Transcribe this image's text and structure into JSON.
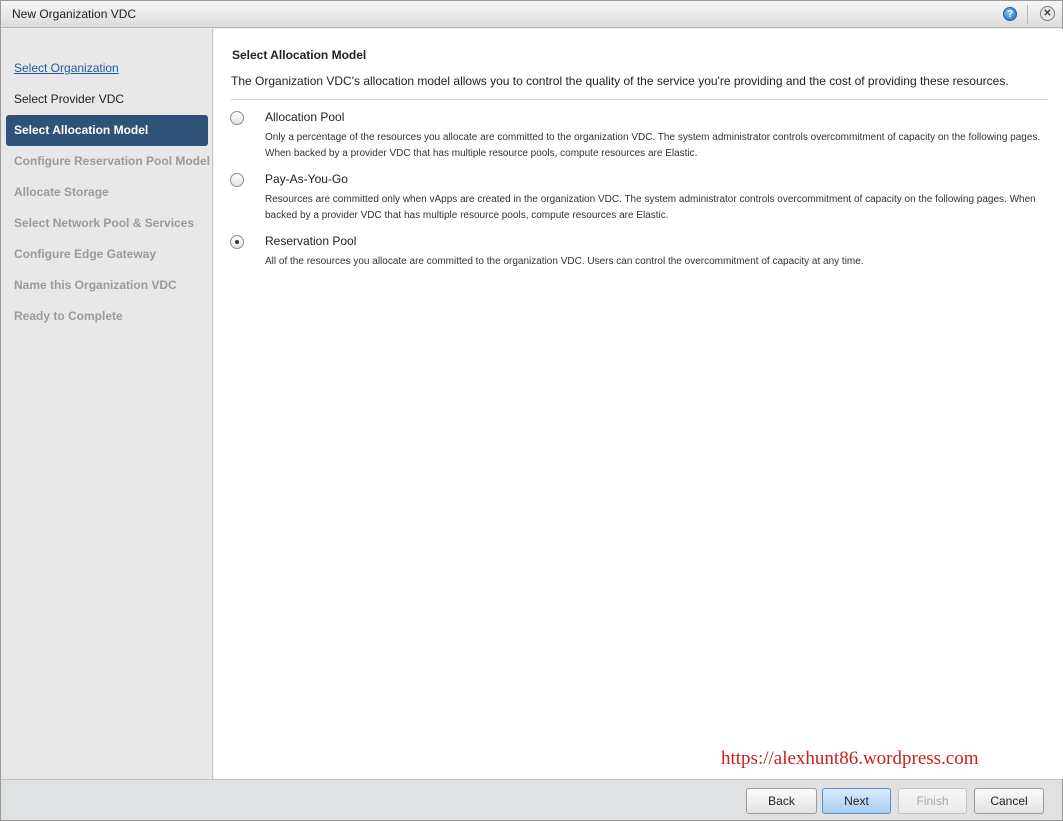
{
  "window": {
    "title": "New Organization VDC",
    "help_icon": "help-icon",
    "help_glyph": "?",
    "close_icon": "close-icon",
    "close_glyph": "✕"
  },
  "sidebar": {
    "steps": [
      {
        "label": "Select Organization",
        "state": "link"
      },
      {
        "label": "Select Provider VDC",
        "state": "done"
      },
      {
        "label": "Select Allocation Model",
        "state": "active"
      },
      {
        "label": "Configure Reservation Pool Model",
        "state": "disabled"
      },
      {
        "label": "Allocate Storage",
        "state": "disabled"
      },
      {
        "label": "Select Network Pool & Services",
        "state": "disabled"
      },
      {
        "label": "Configure Edge Gateway",
        "state": "disabled"
      },
      {
        "label": "Name this Organization VDC",
        "state": "disabled"
      },
      {
        "label": "Ready to Complete",
        "state": "disabled"
      }
    ]
  },
  "main": {
    "title": "Select Allocation Model",
    "description": "The Organization VDC's allocation model allows you to control the quality of the service you're providing and the cost of providing these resources.",
    "options": [
      {
        "label": "Allocation Pool",
        "description": "Only a percentage of the resources you allocate are committed to the organization VDC. The system administrator controls overcommitment of capacity on the following pages. When backed by a provider VDC that has multiple resource pools, compute resources are Elastic.",
        "selected": false
      },
      {
        "label": "Pay-As-You-Go",
        "description": "Resources are committed only when vApps are created in the organization VDC. The system administrator controls overcommitment of capacity on the following pages. When backed by a provider VDC that has multiple resource pools, compute resources are Elastic.",
        "selected": false
      },
      {
        "label": "Reservation Pool",
        "description": "All of the resources you allocate are committed to the organization VDC. Users can control the overcommitment of capacity at any time.",
        "selected": true
      }
    ]
  },
  "watermark": "https://alexhunt86.wordpress.com",
  "footer": {
    "back_label": "Back",
    "next_label": "Next",
    "finish_label": "Finish",
    "cancel_label": "Cancel"
  },
  "colors": {
    "active_step_bg": "#2f5378",
    "link_color": "#1d5a9c",
    "watermark_color": "#cc1e1e"
  }
}
